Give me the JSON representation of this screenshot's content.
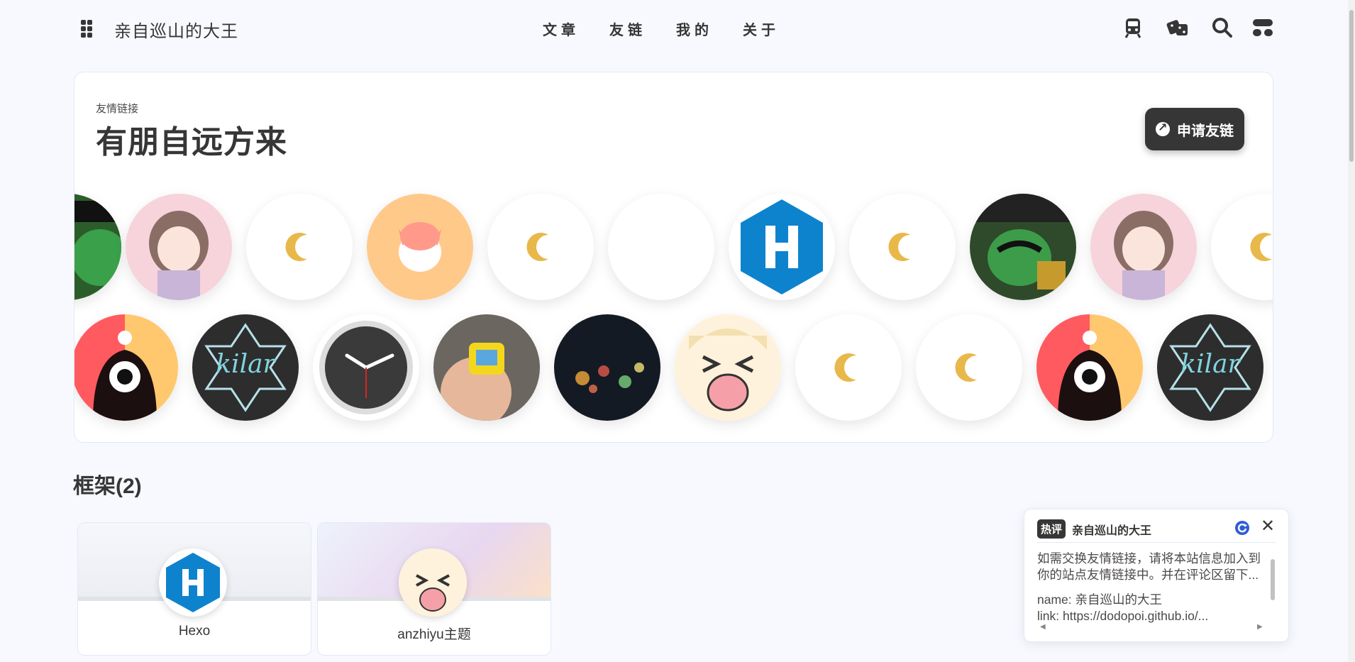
{
  "nav": {
    "site_name": "亲自巡山的大王",
    "links": [
      "文章",
      "友链",
      "我的",
      "关于"
    ]
  },
  "banner": {
    "subtitle": "友情链接",
    "title": "有朋自远方来",
    "apply_button": "申请友链"
  },
  "section": {
    "title": "框架(2)",
    "frameworks": [
      {
        "name": "Hexo"
      },
      {
        "name": "anzhiyu主题"
      }
    ]
  },
  "popup": {
    "tag": "热评",
    "title": "亲自巡山的大王",
    "line1": "如需交换友情链接，请将本站信息加入到你的站点友情链接中。并在评论区留下...",
    "line2": "name: 亲自巡山的大王",
    "line3": "link: https://dodopoi.github.io/..."
  },
  "colors": {
    "accent_dark": "#363636",
    "page_bg": "#f7f9fe",
    "hexo_blue": "#0e83cd"
  }
}
